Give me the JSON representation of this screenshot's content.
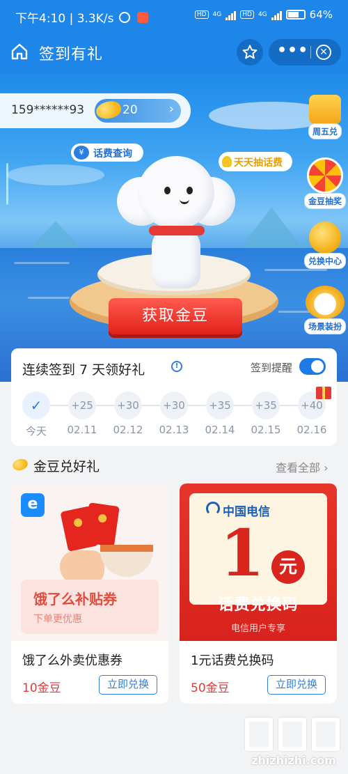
{
  "status_bar": {
    "time_speed": "下午4:10 | 3.3K/s",
    "network_1": "4G",
    "network_2": "4G",
    "hd": "HD",
    "battery": "64%"
  },
  "nav": {
    "title": "签到有礼",
    "more_label": "•••"
  },
  "account": {
    "phone": "159******93",
    "beans": "20"
  },
  "hero": {
    "fee_query": "话费查询",
    "daily_draw": "天天抽话费",
    "get_beans_button": "获取金豆"
  },
  "side_menu": [
    {
      "label": "周五兑",
      "icon": "gift-box-icon"
    },
    {
      "label": "金豆抽奖",
      "icon": "prize-wheel-icon"
    },
    {
      "label": "兑换中心",
      "icon": "coin-exchange-icon"
    },
    {
      "label": "场景装扮",
      "icon": "mascot-dressup-icon"
    }
  ],
  "sign_in": {
    "title": "连续签到 7 天领好礼",
    "info_icon": "!",
    "remind_label": "签到提醒",
    "remind_on": true,
    "days": [
      {
        "reward": "✓",
        "date": "今天",
        "today": true
      },
      {
        "reward": "+25",
        "date": "02.11"
      },
      {
        "reward": "+30",
        "date": "02.12"
      },
      {
        "reward": "+30",
        "date": "02.13"
      },
      {
        "reward": "+35",
        "date": "02.14"
      },
      {
        "reward": "+35",
        "date": "02.15"
      },
      {
        "reward": "+40",
        "date": "02.16"
      }
    ]
  },
  "exchange": {
    "title": "金豆兑好礼",
    "view_all": "查看全部 ›",
    "products": [
      {
        "name": "饿了么外卖优惠券",
        "price": "10金豆",
        "button": "立即兑换",
        "logo_letter": "e",
        "banner_title": "饿了么补贴券",
        "banner_sub": "下单更优惠"
      },
      {
        "name": "1元话费兑换码",
        "price": "50金豆",
        "button": "立即兑换",
        "brand": "中国电信",
        "amount": "1",
        "unit": "元",
        "banner_title": "话费兑换码",
        "banner_sub": "电信用户专享"
      }
    ]
  },
  "watermark": {
    "glyph": "值",
    "site": "zhizhizhi.com"
  },
  "colors": {
    "brand_blue": "#1d86e8",
    "action_red": "#e0221c",
    "price_red": "#e53935"
  }
}
